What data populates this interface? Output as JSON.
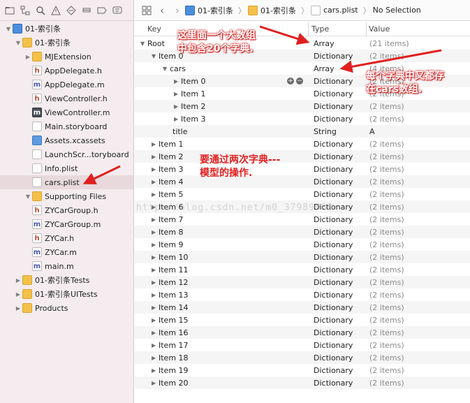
{
  "nav_toolbar": {
    "icons": [
      "folder-icon",
      "hierarchy-icon",
      "search-icon",
      "warning-icon",
      "test-icon",
      "debug-icon",
      "breakpoint-icon",
      "report-icon"
    ]
  },
  "navigator": {
    "items": [
      {
        "label": "01-索引条",
        "kind": "proj",
        "indent": 0,
        "tri": "▼"
      },
      {
        "label": "01-索引条",
        "kind": "folder",
        "indent": 1,
        "tri": "▼"
      },
      {
        "label": "MJExtension",
        "kind": "folder",
        "indent": 2,
        "tri": "▶"
      },
      {
        "label": "AppDelegate.h",
        "kind": "h",
        "indent": 2,
        "tri": ""
      },
      {
        "label": "AppDelegate.m",
        "kind": "m",
        "indent": 2,
        "tri": ""
      },
      {
        "label": "ViewController.h",
        "kind": "h",
        "indent": 2,
        "tri": ""
      },
      {
        "label": "ViewController.m",
        "kind": "mdark",
        "indent": 2,
        "tri": ""
      },
      {
        "label": "Main.storyboard",
        "kind": "sb",
        "indent": 2,
        "tri": ""
      },
      {
        "label": "Assets.xcassets",
        "kind": "assets",
        "indent": 2,
        "tri": ""
      },
      {
        "label": "LaunchScr...toryboard",
        "kind": "sb",
        "indent": 2,
        "tri": ""
      },
      {
        "label": "Info.plist",
        "kind": "plist",
        "indent": 2,
        "tri": ""
      },
      {
        "label": "cars.plist",
        "kind": "plist",
        "indent": 2,
        "tri": "",
        "selected": true
      },
      {
        "label": "Supporting Files",
        "kind": "folder",
        "indent": 2,
        "tri": "▼"
      },
      {
        "label": "ZYCarGroup.h",
        "kind": "h",
        "indent": 2,
        "tri": ""
      },
      {
        "label": "ZYCarGroup.m",
        "kind": "m",
        "indent": 2,
        "tri": ""
      },
      {
        "label": "ZYCar.h",
        "kind": "h",
        "indent": 2,
        "tri": ""
      },
      {
        "label": "ZYCar.m",
        "kind": "m",
        "indent": 2,
        "tri": ""
      },
      {
        "label": "main.m",
        "kind": "m",
        "indent": 2,
        "tri": ""
      },
      {
        "label": "01-索引条Tests",
        "kind": "folder",
        "indent": 1,
        "tri": "▶"
      },
      {
        "label": "01-索引条UITests",
        "kind": "folder",
        "indent": 1,
        "tri": "▶"
      },
      {
        "label": "Products",
        "kind": "folder",
        "indent": 1,
        "tri": "▶"
      }
    ]
  },
  "jumpbar": {
    "crumbs": [
      "01-索引条",
      "01-索引条",
      "cars.plist",
      "No Selection"
    ]
  },
  "columns": {
    "key": "Key",
    "type": "Type",
    "value": "Value"
  },
  "plist_rows": [
    {
      "key": "Root",
      "type": "Array",
      "value": "(21 items)",
      "indent": 0,
      "tri": "▼"
    },
    {
      "key": "Item 0",
      "type": "Dictionary",
      "value": "(2 items)",
      "indent": 1,
      "tri": "▼"
    },
    {
      "key": "cars",
      "type": "Array",
      "value": "(4 items)",
      "indent": 2,
      "tri": "▼"
    },
    {
      "key": "Item 0",
      "type": "Dictionary",
      "value": "(2 items)",
      "indent": 3,
      "tri": "▶",
      "controls": true
    },
    {
      "key": "Item 1",
      "type": "Dictionary",
      "value": "(2 items)",
      "indent": 3,
      "tri": "▶"
    },
    {
      "key": "Item 2",
      "type": "Dictionary",
      "value": "(2 items)",
      "indent": 3,
      "tri": "▶"
    },
    {
      "key": "Item 3",
      "type": "Dictionary",
      "value": "(2 items)",
      "indent": 3,
      "tri": "▶"
    },
    {
      "key": "title",
      "type": "String",
      "value": "A",
      "indent": 2,
      "tri": "",
      "plain": true
    },
    {
      "key": "Item 1",
      "type": "Dictionary",
      "value": "(2 items)",
      "indent": 1,
      "tri": "▶"
    },
    {
      "key": "Item 2",
      "type": "Dictionary",
      "value": "(2 items)",
      "indent": 1,
      "tri": "▶"
    },
    {
      "key": "Item 3",
      "type": "Dictionary",
      "value": "(2 items)",
      "indent": 1,
      "tri": "▶"
    },
    {
      "key": "Item 4",
      "type": "Dictionary",
      "value": "(2 items)",
      "indent": 1,
      "tri": "▶"
    },
    {
      "key": "Item 5",
      "type": "Dictionary",
      "value": "(2 items)",
      "indent": 1,
      "tri": "▶"
    },
    {
      "key": "Item 6",
      "type": "Dictionary",
      "value": "(2 items)",
      "indent": 1,
      "tri": "▶"
    },
    {
      "key": "Item 7",
      "type": "Dictionary",
      "value": "(2 items)",
      "indent": 1,
      "tri": "▶"
    },
    {
      "key": "Item 8",
      "type": "Dictionary",
      "value": "(2 items)",
      "indent": 1,
      "tri": "▶"
    },
    {
      "key": "Item 9",
      "type": "Dictionary",
      "value": "(2 items)",
      "indent": 1,
      "tri": "▶"
    },
    {
      "key": "Item 10",
      "type": "Dictionary",
      "value": "(2 items)",
      "indent": 1,
      "tri": "▶"
    },
    {
      "key": "Item 11",
      "type": "Dictionary",
      "value": "(2 items)",
      "indent": 1,
      "tri": "▶"
    },
    {
      "key": "Item 12",
      "type": "Dictionary",
      "value": "(2 items)",
      "indent": 1,
      "tri": "▶"
    },
    {
      "key": "Item 13",
      "type": "Dictionary",
      "value": "(2 items)",
      "indent": 1,
      "tri": "▶"
    },
    {
      "key": "Item 14",
      "type": "Dictionary",
      "value": "(2 items)",
      "indent": 1,
      "tri": "▶"
    },
    {
      "key": "Item 15",
      "type": "Dictionary",
      "value": "(2 items)",
      "indent": 1,
      "tri": "▶"
    },
    {
      "key": "Item 16",
      "type": "Dictionary",
      "value": "(2 items)",
      "indent": 1,
      "tri": "▶"
    },
    {
      "key": "Item 17",
      "type": "Dictionary",
      "value": "(2 items)",
      "indent": 1,
      "tri": "▶"
    },
    {
      "key": "Item 18",
      "type": "Dictionary",
      "value": "(2 items)",
      "indent": 1,
      "tri": "▶"
    },
    {
      "key": "Item 19",
      "type": "Dictionary",
      "value": "(2 items)",
      "indent": 1,
      "tri": "▶"
    },
    {
      "key": "Item 20",
      "type": "Dictionary",
      "value": "(2 items)",
      "indent": 1,
      "tri": "▶"
    }
  ],
  "annotations": {
    "top_line1": "这里面一个大数组",
    "top_line2": "中包含20个字典.",
    "right_line1": "每个字典中又都存",
    "right_line2": "在cars数组.",
    "mid_line1": "要通过两次字典---",
    "mid_line2": "模型的操作."
  },
  "watermark": "http://blog.csdn.net/m0_37989980",
  "colors": {
    "annotation_red": "#e02020",
    "selection": "#e8d9dc"
  }
}
